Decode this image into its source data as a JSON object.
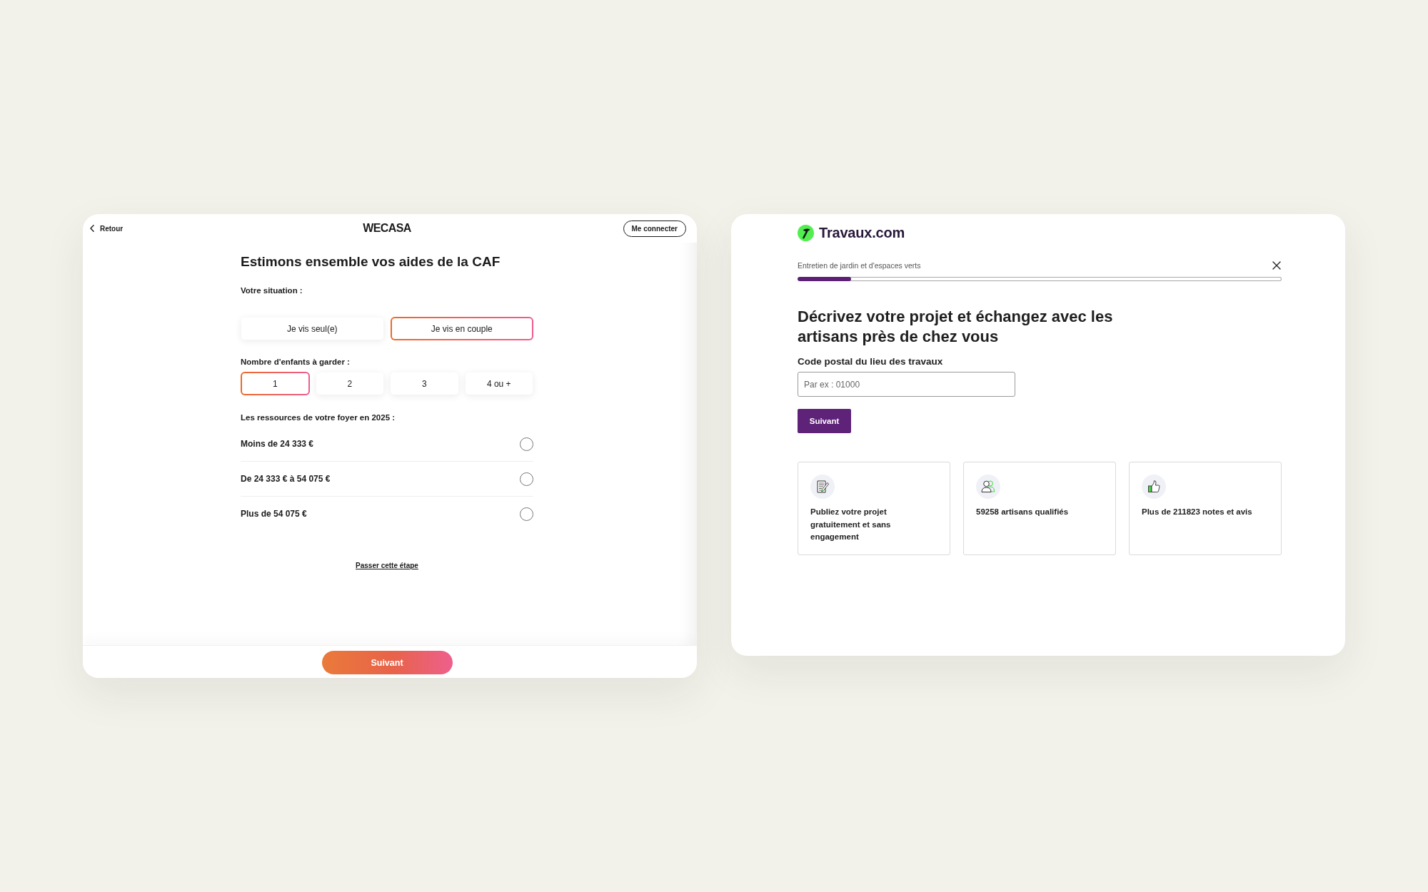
{
  "wecasa": {
    "back_link": "Retour",
    "logo": "WECASA",
    "login_button": "Me connecter",
    "title": "Estimons ensemble vos aides de la CAF",
    "situation": {
      "label": "Votre situation :",
      "options": [
        {
          "label": "Je vis seul(e)",
          "selected": false
        },
        {
          "label": "Je vis en couple",
          "selected": true
        }
      ]
    },
    "kids_count": {
      "label": "Nombre d'enfants à garder :",
      "options": [
        {
          "label": "1",
          "selected": true
        },
        {
          "label": "2",
          "selected": false
        },
        {
          "label": "3",
          "selected": false
        },
        {
          "label": "4 ou +",
          "selected": false
        }
      ]
    },
    "resources": {
      "label": "Les ressources de votre foyer en 2025 :",
      "options": [
        {
          "label": "Moins de 24 333 €",
          "selected": false
        },
        {
          "label": "De 24 333 € à 54 075 €",
          "selected": false
        },
        {
          "label": "Plus de 54 075 €",
          "selected": false
        }
      ]
    },
    "skip_link": "Passer cette étape",
    "next_button": "Suivant"
  },
  "travaux": {
    "logo": "Travaux.com",
    "category": "Entretien de jardin et d'espaces verts",
    "progress": {
      "level": 0.11
    },
    "heading": "Décrivez votre projet et échangez avec les artisans près de chez vous",
    "postal_code": {
      "label": "Code postal du lieu des travaux",
      "placeholder": "Par ex : 01000"
    },
    "next_button": "Suivant",
    "features": [
      {
        "kind": "document",
        "text": "Publiez votre projet gratuitement et sans engagement"
      },
      {
        "kind": "people",
        "text": "59258 artisans qualifiés"
      },
      {
        "kind": "thumbs-up",
        "text": "Plus de 211823 notes et avis"
      }
    ]
  }
}
